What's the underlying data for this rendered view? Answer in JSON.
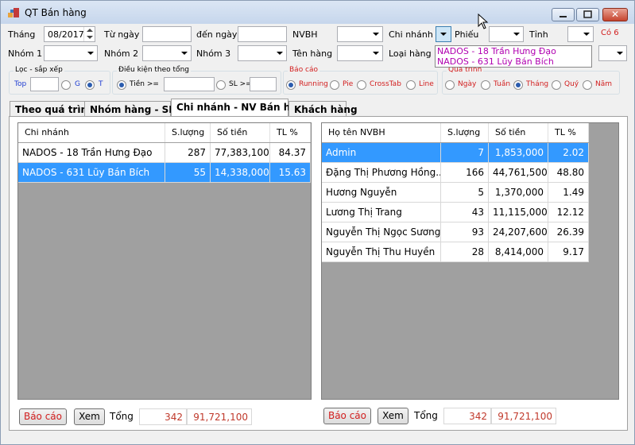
{
  "window": {
    "title": "QT Bán hàng"
  },
  "filters": {
    "thang_label": "Tháng",
    "thang_value": "08/2017",
    "tu_ngay_label": "Từ ngày",
    "den_ngay_label": "đến ngày",
    "nvbh_label": "NVBH",
    "chi_nhanh_label": "Chi nhánh",
    "phieu_label": "Phiếu",
    "tinh_label": "Tỉnh",
    "co_label": "Có 6",
    "nhom1_label": "Nhóm 1",
    "nhom2_label": "Nhóm 2",
    "nhom3_label": "Nhóm 3",
    "ten_hang_label": "Tên hàng",
    "loai_hang_label": "Loại hàng"
  },
  "branch_dropdown": {
    "options": [
      "NADOS - 18 Trần Hưng Đạo",
      "NADOS - 631 Lũy Bán Bích"
    ]
  },
  "loc_sap_xep": {
    "title": "Lọc - sắp xếp",
    "top_label": "Top",
    "g_label": "G",
    "t_label": "T",
    "selected": "T"
  },
  "dieu_kien": {
    "title": "Điều kiện theo tổng",
    "tien_label": "Tiền >=",
    "sl_label": "SL >=",
    "selected": "Tiền"
  },
  "bao_cao": {
    "title": "Báo cáo",
    "options": [
      "Running",
      "Pie",
      "CrossTab",
      "Line"
    ],
    "selected": "Running"
  },
  "qua_trinh": {
    "title": "Quá trình",
    "options": [
      "Ngày",
      "Tuần",
      "Tháng",
      "Quý",
      "Năm"
    ],
    "selected": "Tháng"
  },
  "tabs": [
    "Theo quá trình",
    "Nhóm hàng - SKUs",
    "Chi nhánh - NV Bán hàng",
    "Khách hàng"
  ],
  "active_tab": "Chi nhánh - NV Bán hàng",
  "left_grid": {
    "columns": [
      "Chi nhánh",
      "S.lượng",
      "Số tiền",
      "TL %"
    ],
    "rows": [
      [
        "NADOS - 18 Trần Hưng Đạo",
        "287",
        "77,383,100",
        "84.37"
      ],
      [
        "NADOS - 631 Lũy Bán Bích",
        "55",
        "14,338,000",
        "15.63"
      ]
    ],
    "selected_row": 1
  },
  "right_grid": {
    "columns": [
      "Họ tên NVBH",
      "S.lượng",
      "Số tiền",
      "TL %"
    ],
    "rows": [
      [
        "Admin",
        "7",
        "1,853,000",
        "2.02"
      ],
      [
        "Đặng Thị Phương Hồng...",
        "166",
        "44,761,500",
        "48.80"
      ],
      [
        "Hương Nguyễn",
        "5",
        "1,370,000",
        "1.49"
      ],
      [
        "Lương Thị Trang",
        "43",
        "11,115,000",
        "12.12"
      ],
      [
        "Nguyễn Thị Ngọc Sương",
        "93",
        "24,207,600",
        "26.39"
      ],
      [
        "Nguyễn Thị Thu Huyền",
        "28",
        "8,414,000",
        "9.17"
      ]
    ],
    "selected_row": 0
  },
  "footer_left": {
    "bao_cao": "Báo cáo",
    "xem": "Xem",
    "tong": "Tổng",
    "qty": "342",
    "amount": "91,721,100"
  },
  "footer_right": {
    "bao_cao": "Báo cáo",
    "xem": "Xem",
    "tong": "Tổng",
    "qty": "342",
    "amount": "91,721,100"
  },
  "colors": {
    "selection": "#3399ff",
    "accent_red": "#d21e1e",
    "grid_bg": "#a0a0a0"
  }
}
